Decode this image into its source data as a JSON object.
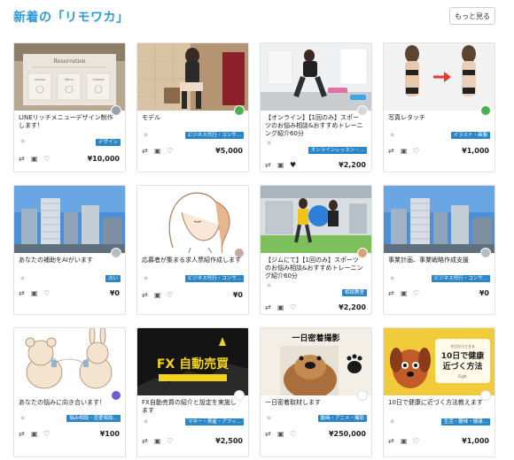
{
  "header": {
    "title": "新着の「リモワカ」",
    "more_label": "もっと見る"
  },
  "icons": {
    "star": "star-icon",
    "compare": "compare-icon",
    "chat": "chat-icon",
    "favorite": "heart-icon"
  },
  "colors": {
    "accent": "#2b9bd8",
    "badge": "#2b86c8"
  },
  "cards": [
    {
      "title": "LINEリッチメニューデザイン制作します！",
      "badge": "デザイン",
      "price": "¥10,000",
      "favorited": false
    },
    {
      "title": "モデル",
      "badge": "ビジネス代行・コンサ...",
      "price": "¥5,000",
      "favorited": false
    },
    {
      "title": "【オンライン】【1回のみ】スポーツのお悩み相談&おすすめトレーニング紹介60分",
      "badge": "オンラインレッスン・...",
      "price": "¥2,200",
      "favorited": true
    },
    {
      "title": "写真レタッチ",
      "badge": "イラスト・画像",
      "price": "¥1,000",
      "favorited": false
    },
    {
      "title": "あなたの補助をAIがいます",
      "badge": "占い",
      "price": "¥0",
      "favorited": false
    },
    {
      "title": "応募者が集まる求人票紹作成します",
      "badge": "ビジネス代行・コンサ...",
      "price": "¥0",
      "favorited": false
    },
    {
      "title": "【ジムにて】【1回のみ】スポーツのお悩み相談&おすすめトレーニング紹介60分",
      "badge": "相談教室",
      "price": "¥2,200",
      "favorited": false
    },
    {
      "title": "事業計画、事業戦略作成支援",
      "badge": "ビジネス代行・コンサ...",
      "price": "¥0",
      "favorited": false
    },
    {
      "title": "あなたの悩みに向き合います！",
      "badge": "悩み相談・恋愛相談...",
      "price": "¥100",
      "favorited": false
    },
    {
      "title": "FX自動売買の紹介と設定を実施します",
      "badge": "マネー・資産・アフィ...",
      "price": "¥2,500",
      "favorited": false
    },
    {
      "title": "一日密着取材します",
      "badge": "動画・アニメ・撮影",
      "price": "¥250,000",
      "favorited": false
    },
    {
      "title": "10日で健康に近づく方法教えます",
      "badge": "生活・趣味・健康...",
      "price": "¥1,000",
      "favorited": false
    }
  ],
  "thumbs": {
    "menu_signs": [
      "Reservation",
      "Access",
      "Menu",
      "Contact"
    ],
    "fx_text": "FX 自動売買",
    "dog_banner": "一日密着撮影",
    "health_small": "今日からできる",
    "health_big": "10日で健康",
    "health_big2": "近づく方法",
    "health_tag": "Fight"
  }
}
